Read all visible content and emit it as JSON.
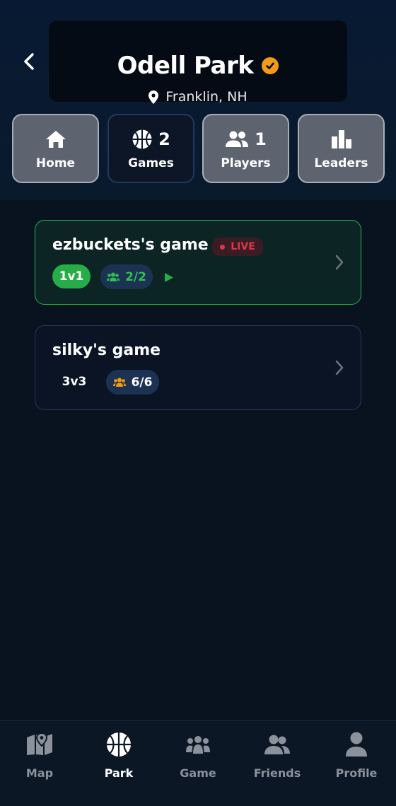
{
  "header": {
    "park_name": "Odell Park",
    "location": "Franklin, NH",
    "icons": {
      "back": "chevron-left-icon",
      "verified": "check-badge-icon",
      "location": "map-pin-icon"
    }
  },
  "tabs": [
    {
      "label": "Home",
      "count": "",
      "icon": "home-icon",
      "active": false
    },
    {
      "label": "Games",
      "count": "2",
      "icon": "basketball-icon",
      "active": true
    },
    {
      "label": "Players",
      "count": "1",
      "icon": "people-icon",
      "active": false
    },
    {
      "label": "Leaders",
      "count": "",
      "icon": "bar-chart-icon",
      "active": false
    }
  ],
  "games": [
    {
      "title": "ezbuckets's game",
      "live_label": "LIVE",
      "mode": "1v1",
      "players": "2/2",
      "live": true
    },
    {
      "title": "silky's game",
      "live_label": "",
      "mode": "3v3",
      "players": "6/6",
      "live": false
    }
  ],
  "bottom_nav": [
    {
      "label": "Map",
      "icon": "map-icon",
      "active": false
    },
    {
      "label": "Park",
      "icon": "basketball-icon",
      "active": true
    },
    {
      "label": "Game",
      "icon": "group-icon",
      "active": false
    },
    {
      "label": "Friends",
      "icon": "friends-icon",
      "active": false
    },
    {
      "label": "Profile",
      "icon": "person-icon",
      "active": false
    }
  ],
  "colors": {
    "background": "#091320",
    "accent_orange": "#f39a1b",
    "live_green": "#27ad47",
    "live_red": "#e0344a",
    "pill_blue": "#1b3253"
  }
}
